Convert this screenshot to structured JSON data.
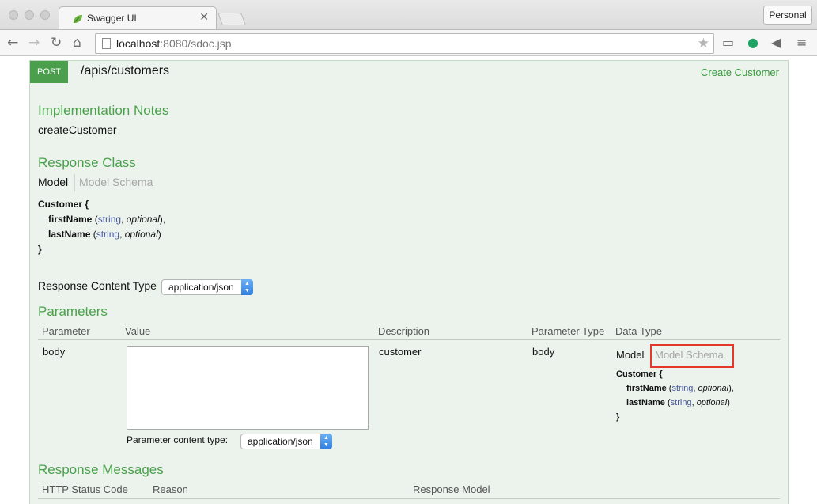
{
  "browser": {
    "tab_title": "Swagger UI",
    "tab_close": "✕",
    "profile": "Personal",
    "url_host": "localhost",
    "url_rest": ":8080/sdoc.jsp"
  },
  "operation": {
    "method": "POST",
    "path": "/apis/customers",
    "summary": "Create Customer",
    "impl_notes_title": "Implementation Notes",
    "impl_notes": "createCustomer",
    "response_class_title": "Response Class",
    "model_tab": "Model",
    "model_schema_tab": "Model Schema",
    "model": {
      "name": "Customer {",
      "close": "}",
      "fields": [
        {
          "name": "firstName",
          "open": " (",
          "type": "string",
          "comma": ", ",
          "optional": "optional",
          "close": "),"
        },
        {
          "name": "lastName",
          "open": " (",
          "type": "string",
          "comma": ", ",
          "optional": "optional",
          "close": ")"
        }
      ]
    },
    "response_content_type_label": "Response Content Type",
    "response_content_type": "application/json",
    "parameters_title": "Parameters",
    "param_headers": [
      "Parameter",
      "Value",
      "Description",
      "Parameter Type",
      "Data Type"
    ],
    "param_row": {
      "name": "body",
      "description": "customer",
      "param_type": "body",
      "model_tab": "Model",
      "model_schema_tab": "Model Schema"
    },
    "param_content_type_label": "Parameter content type:",
    "param_content_type": "application/json",
    "response_messages_title": "Response Messages",
    "response_headers": [
      "HTTP Status Code",
      "Reason",
      "Response Model"
    ]
  }
}
